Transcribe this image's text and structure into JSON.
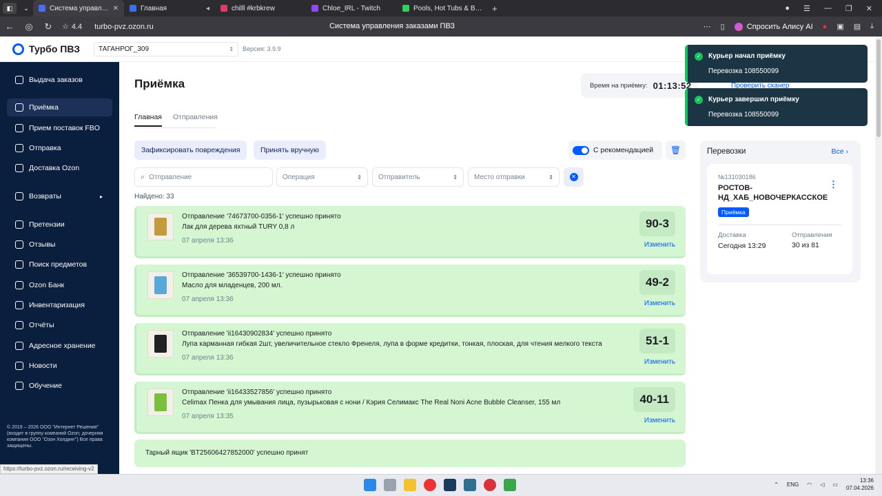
{
  "browser": {
    "tabs": [
      {
        "title": "Система управления",
        "color": "#4a6cf7",
        "active": true
      },
      {
        "title": "Главная",
        "color": "#3a6df0",
        "active": false
      },
      {
        "title": "chilll #krbkrew",
        "color": "#e03a6a",
        "active": false
      },
      {
        "title": "Chloe_IRL - Twitch",
        "color": "#9146ff",
        "active": false
      },
      {
        "title": "Pools, Hot Tubs & Bikinis S",
        "color": "#2fd15a",
        "active": false
      }
    ],
    "rating": "4.4",
    "url": "turbo-pvz.ozon.ru",
    "page_title": "Система управления заказами ПВЗ",
    "alice_label": "Спросить Алису AI"
  },
  "app": {
    "logo_text": "Турбо ПВЗ",
    "pvz_name": "ТАГАНРОГ_309",
    "version": "Версия: 3.9.9"
  },
  "sidebar": {
    "items": [
      {
        "label": "Выдача заказов",
        "icon": "box-icon"
      },
      {
        "label": "Приёмка",
        "icon": "package-icon"
      },
      {
        "label": "Прием поставок FBO",
        "icon": "truck-icon"
      },
      {
        "label": "Отправка",
        "icon": "send-icon"
      },
      {
        "label": "Доставка Ozon",
        "icon": "delivery-icon"
      },
      {
        "label": "Возвраты",
        "icon": "return-icon"
      },
      {
        "label": "Претензии",
        "icon": "claim-icon"
      },
      {
        "label": "Отзывы",
        "icon": "review-icon"
      },
      {
        "label": "Поиск предметов",
        "icon": "search-icon"
      },
      {
        "label": "Ozon Банк",
        "icon": "bank-icon"
      },
      {
        "label": "Инвентаризация",
        "icon": "inventory-icon"
      },
      {
        "label": "Отчёты",
        "icon": "report-icon"
      },
      {
        "label": "Адресное хранение",
        "icon": "storage-icon"
      },
      {
        "label": "Новости",
        "icon": "news-icon"
      },
      {
        "label": "Обучение",
        "icon": "education-icon"
      }
    ],
    "copyright": "© 2019 – 2026 ООО \"Интернет Решения\" (входит в группу компаний Ozon; дочерняя компания ООО \"Озон Холдинг\") Все права защищены.",
    "status_url": "https://turbo-pvz.ozon.ru/receiving-v2"
  },
  "main": {
    "title": "Приёмка",
    "timer_label": "Время на приёмку:",
    "timer_value": "01:13:52",
    "scanner_link": "Проверить сканер",
    "tabs": [
      "Главная",
      "Отправления"
    ],
    "btn_damage": "Зафиксировать повреждения",
    "btn_manual": "Принять вручную",
    "recommend_label": "С рекомендацией",
    "filters": {
      "shipment": "Отправление",
      "operation": "Операция",
      "sender": "Отправитель",
      "place": "Место отправки"
    },
    "found": "Найдено: 33",
    "edit_label": "Изменить",
    "shipments": [
      {
        "head": "Отправление '74673700-0356-1' успешно принято",
        "desc": "Лак для дерева яхтный TURY 0,8 л",
        "time": "07 апреля 13:36",
        "cell": "90-3",
        "thumb_color": "#c59a3e"
      },
      {
        "head": "Отправление '36539700-1436-1' успешно принято",
        "desc": "Масло для младенцев, 200 мл.",
        "time": "07 апреля 13:36",
        "cell": "49-2",
        "thumb_color": "#5aa7d9"
      },
      {
        "head": "Отправление 'ii16430902834' успешно принято",
        "desc": "Лупа карманная гибкая 2шт, увеличительное стекло Френеля, лупа в форме кредитки, тонкая, плоская, для чтения мелкого текста",
        "time": "07 апреля 13:36",
        "cell": "51-1",
        "thumb_color": "#222222"
      },
      {
        "head": "Отправление 'ii16433527856' успешно принято",
        "desc": "Celimax Пенка для умывания лица, пузырьковая с нони / Кэрия Селимакс The Real Noni Acne Bubble Cleanser, 155 мл",
        "time": "07 апреля 13:35",
        "cell": "40-11",
        "thumb_color": "#7bbf3a"
      }
    ],
    "box_message": "Тарный ящик 'BT25606427852000' успешно принят"
  },
  "trips_panel": {
    "title": "Перевозки",
    "all_label": "Все",
    "trip": {
      "number": "№131030186",
      "name": "РОСТОВ-НД_ХАБ_НОВОЧЕРКАССКОЕ",
      "badge": "Приёмка",
      "delivery_label": "Доставка",
      "delivery_value": "Сегодня 13:29",
      "shipments_label": "Отправления",
      "shipments_value": "30 из 81"
    }
  },
  "toasts": [
    {
      "title": "Курьер начал приёмку",
      "text": "Перевозка 108550099"
    },
    {
      "title": "Курьер завершил приёмку",
      "text": "Перевозка 108550099"
    }
  ],
  "taskbar": {
    "lang": "ENG",
    "time": "13:36",
    "date": "07.04.2026"
  }
}
